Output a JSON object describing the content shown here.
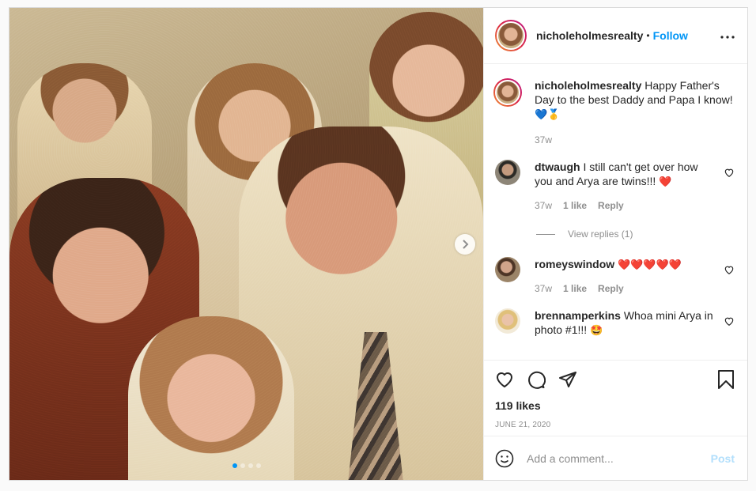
{
  "post": {
    "username": "nicholeholmesrealty",
    "follow_label": "Follow",
    "dot_separator": "•",
    "more_label": "•••",
    "caption": {
      "username": "nicholeholmesrealty",
      "text": "Happy Father's Day to the best Daddy and Papa I know!",
      "emoji": "💙🥇",
      "time": "37w"
    },
    "comments": [
      {
        "username": "dtwaugh",
        "text": "I still can't get over how you and Arya are twins!!!",
        "emoji": "❤️",
        "time": "37w",
        "likes": "1 like",
        "reply": "Reply",
        "view_replies": "View replies (1)"
      },
      {
        "username": "romeyswindow",
        "text": "",
        "emoji": "❤️❤️❤️❤️❤️",
        "time": "37w",
        "likes": "1 like",
        "reply": "Reply"
      },
      {
        "username": "brennamperkins",
        "text": "Whoa mini Arya in photo #1!!!",
        "emoji": "🤩"
      }
    ],
    "likes_count": "119 likes",
    "date": "JUNE 21, 2020",
    "comment_placeholder": "Add a comment...",
    "post_button": "Post",
    "carousel": {
      "slides": 4,
      "active_index": 0
    }
  },
  "colors": {
    "accent": "#0095f6",
    "heart": "#ed1c24",
    "muted": "#8e8e8e",
    "border": "#dbdbdb",
    "post_disabled": "#b2dffc"
  }
}
